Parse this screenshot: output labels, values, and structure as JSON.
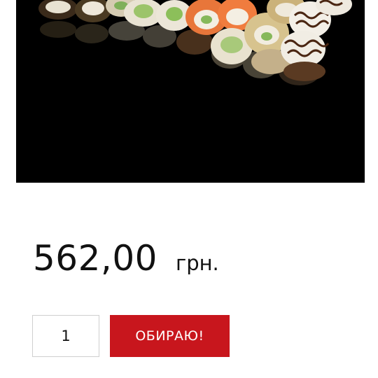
{
  "product": {
    "image_icon": "sushi-set-photo",
    "price_amount": "562,00",
    "price_currency": "грн."
  },
  "cart": {
    "quantity_value": "1",
    "add_button_label": "ОБИРАЮ!"
  },
  "colors": {
    "accent": "#c8161d",
    "image_background": "#000000"
  }
}
